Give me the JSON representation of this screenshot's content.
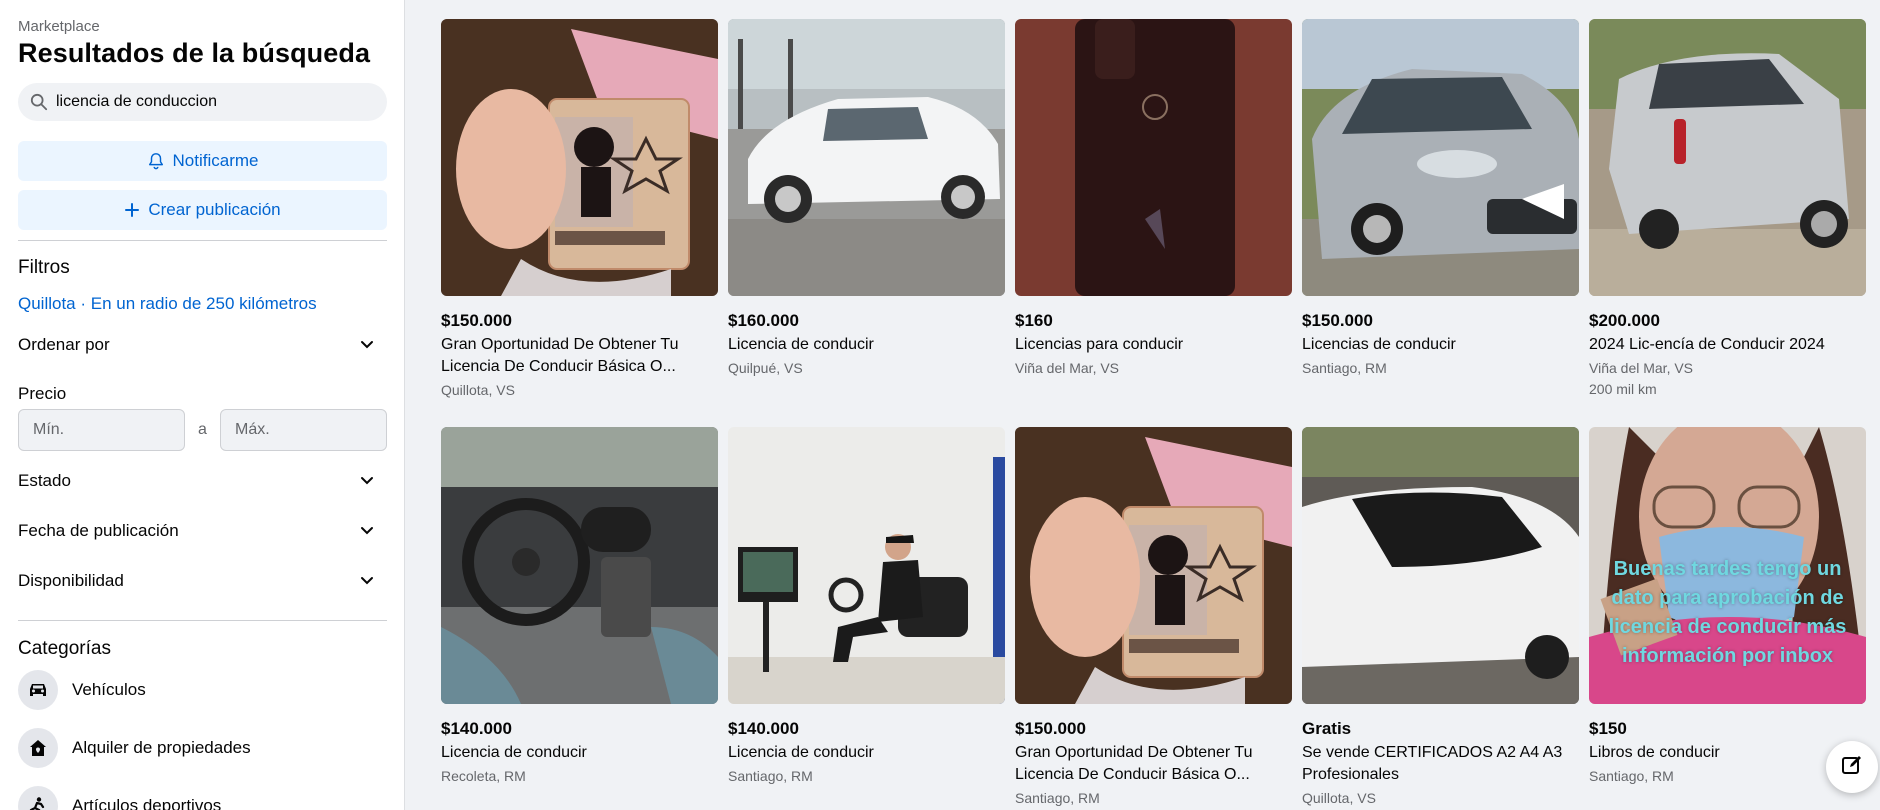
{
  "sidebar": {
    "breadcrumb": "Marketplace",
    "title": "Resultados de la búsqueda",
    "search_value": "licencia de conduccion",
    "notify_label": "Notificarme",
    "create_label": "Crear publicación",
    "filters_heading": "Filtros",
    "location_text": "Quillota · En un radio de 250 kilómetros",
    "sort_label": "Ordenar por",
    "price_label": "Precio",
    "min_placeholder": "Mín.",
    "price_separator": "a",
    "max_placeholder": "Máx.",
    "condition_label": "Estado",
    "date_label": "Fecha de publicación",
    "availability_label": "Disponibilidad",
    "categories_heading": "Categorías",
    "categories": [
      {
        "label": "Vehículos",
        "icon": "car-icon"
      },
      {
        "label": "Alquiler de propiedades",
        "icon": "house-icon"
      },
      {
        "label": "Artículos deportivos",
        "icon": "sports-icon"
      }
    ]
  },
  "listings": [
    {
      "price": "$150.000",
      "title": "Gran Oportunidad De Obtener Tu Licencia De Conducir Básica O...",
      "location": "Quillota, VS",
      "image": "license-card-photo"
    },
    {
      "price": "$160.000",
      "title": "Licencia de conducir",
      "location": "Quilpué, VS",
      "image": "white-sedan-photo"
    },
    {
      "price": "$160",
      "title": "Licencias para conducir",
      "location": "Viña del Mar, VS",
      "image": "phone-photo"
    },
    {
      "price": "$150.000",
      "title": "Licencias de conducir",
      "location": "Santiago, RM",
      "image": "silver-car-photo"
    },
    {
      "price": "$200.000",
      "title": "2024 Lic-encía de Conducir 2024",
      "location": "Viña del Mar, VS",
      "extra": "200 mil km",
      "image": "silver-hatchback-photo"
    },
    {
      "price": "$140.000",
      "title": "Licencia de conducir",
      "location": "Recoleta, RM",
      "image": "car-interior-photo"
    },
    {
      "price": "$140.000",
      "title": "Licencia de conducir",
      "location": "Santiago, RM",
      "image": "driving-simulator-photo"
    },
    {
      "price": "$150.000",
      "title": "Gran Oportunidad De Obtener Tu Licencia De Conducir Básica O...",
      "location": "Santiago, RM",
      "image": "license-card-photo"
    },
    {
      "price": "Gratis",
      "title": "Se vende CERTIFICADOS A2 A4 A3 Profesionales",
      "location": "Quillota, VS",
      "image": "white-car-top-photo"
    },
    {
      "price": "$150",
      "title": "Libros de conducir",
      "location": "Santiago, RM",
      "image": "woman-mask-photo",
      "overlay_text": "Buenas tardes tengo un dato para aprobación de licencia de conducir más información por inbox"
    }
  ],
  "colors": {
    "accent": "#0064d1",
    "soft_button": "#ebf5ff",
    "background": "#f0f2f5"
  }
}
